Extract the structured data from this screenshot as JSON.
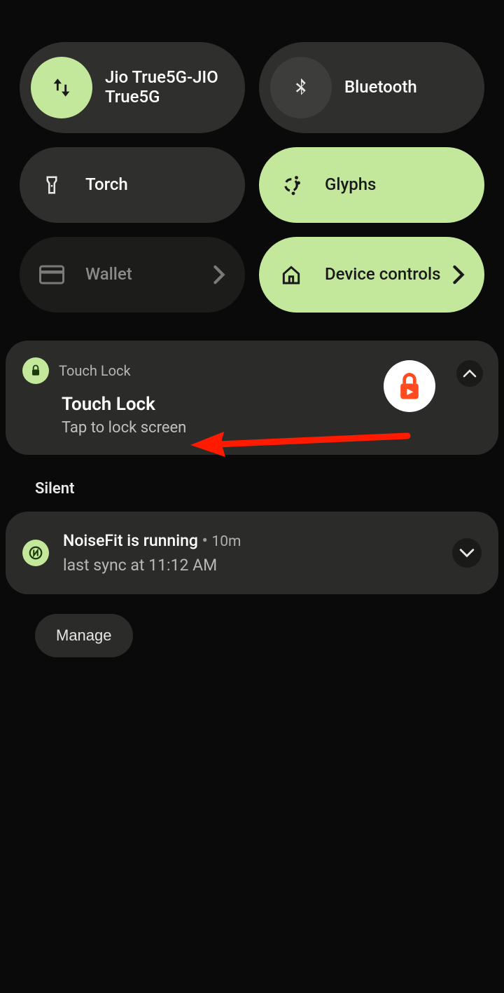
{
  "tiles": {
    "data": {
      "label": "Jio True5G-JIO True5G"
    },
    "bluetooth": {
      "label": "Bluetooth"
    },
    "torch": {
      "label": "Torch"
    },
    "glyphs": {
      "label": "Glyphs"
    },
    "wallet": {
      "label": "Wallet"
    },
    "device_controls": {
      "label": "Device controls"
    }
  },
  "notification1": {
    "app": "Touch Lock",
    "title": "Touch Lock",
    "subtitle": "Tap to lock screen"
  },
  "section_silent": "Silent",
  "notification2": {
    "title": "NoiseFit is running",
    "time": "10m",
    "subtitle": "last sync at 11:12 AM"
  },
  "manage_label": "Manage"
}
